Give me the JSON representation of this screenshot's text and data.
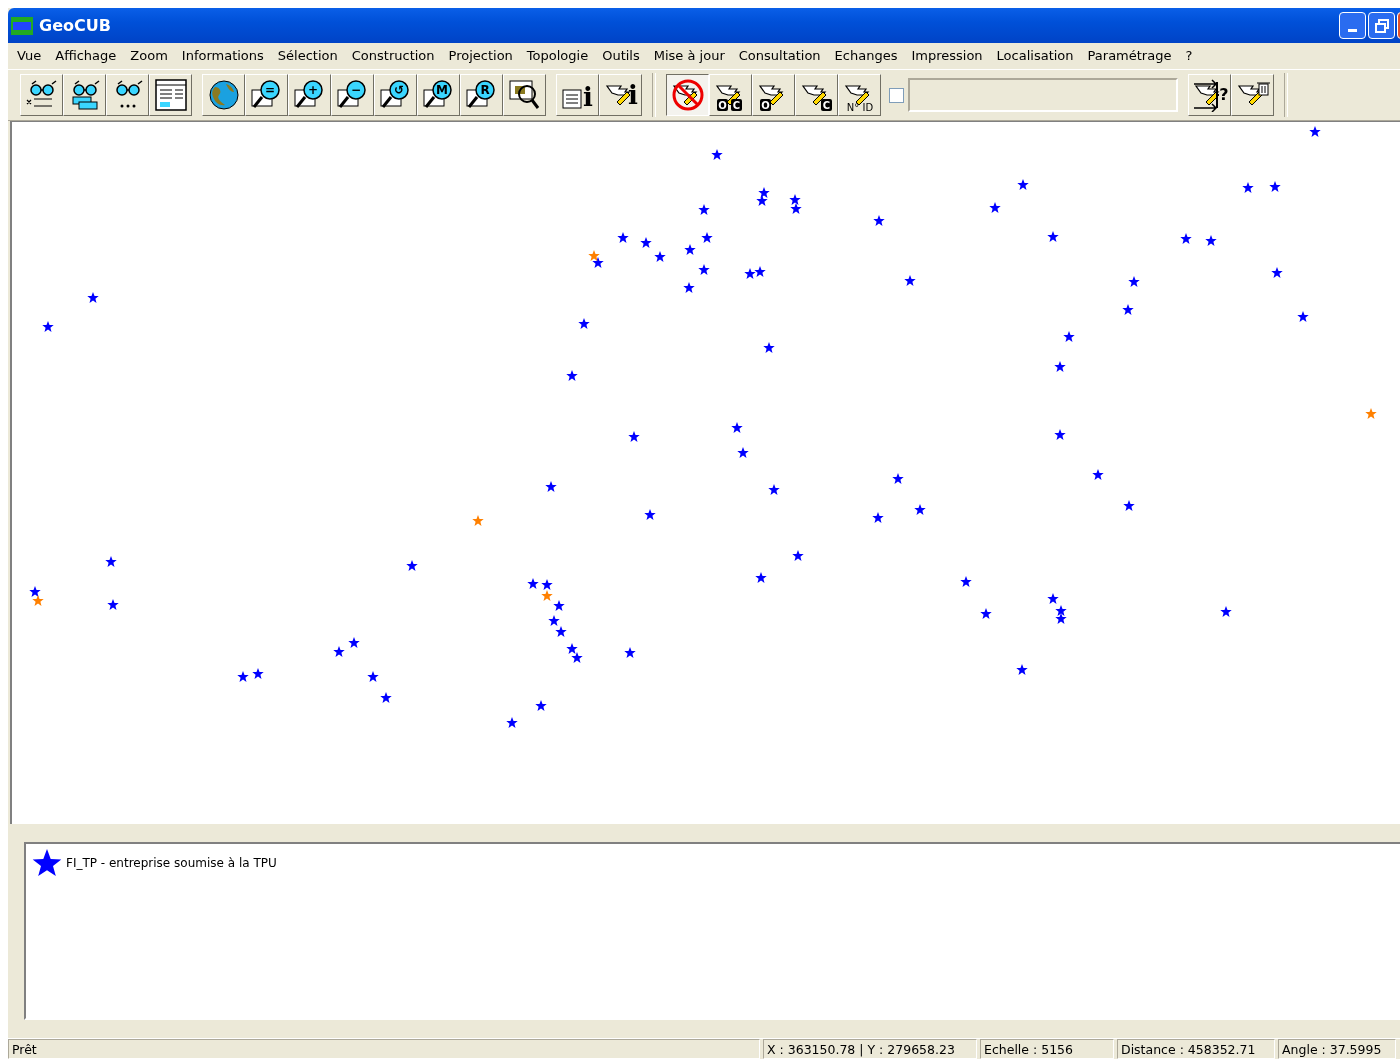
{
  "window": {
    "title": "GeoCUB"
  },
  "menu": [
    "Vue",
    "Affichage",
    "Zoom",
    "Informations",
    "Sélection",
    "Construction",
    "Projection",
    "Topologie",
    "Outils",
    "Mise à jour",
    "Consultation",
    "Echanges",
    "Impression",
    "Localisation",
    "Paramétrage",
    "?"
  ],
  "toolbar": {
    "groups": [
      [
        {
          "kind": "glasses-x",
          "pressed": false
        },
        {
          "kind": "glasses-layers",
          "pressed": false
        },
        {
          "kind": "glasses-dots",
          "pressed": false
        },
        {
          "kind": "table",
          "pressed": false
        }
      ],
      [
        {
          "kind": "globe",
          "pressed": false
        },
        {
          "kind": "zoom",
          "glyph": "=",
          "pressed": false
        },
        {
          "kind": "zoom",
          "glyph": "+",
          "pressed": false
        },
        {
          "kind": "zoom",
          "glyph": "−",
          "pressed": false
        },
        {
          "kind": "zoom",
          "glyph": "↺",
          "pressed": false
        },
        {
          "kind": "zoom",
          "glyph": "M",
          "pressed": false
        },
        {
          "kind": "zoom",
          "glyph": "R",
          "pressed": false
        },
        {
          "kind": "zoom-map",
          "pressed": false
        }
      ],
      [
        {
          "kind": "doc-info",
          "glyph": "i",
          "pressed": false
        },
        {
          "kind": "hand-info",
          "glyph": "i",
          "pressed": false
        }
      ],
      [
        {
          "kind": "hand-no",
          "pressed": true
        },
        {
          "kind": "hand",
          "tags": [
            "O",
            "C"
          ],
          "pressed": false
        },
        {
          "kind": "hand",
          "tags": [
            "O"
          ],
          "pressed": false
        },
        {
          "kind": "hand",
          "tags": [
            "C"
          ],
          "pressed": false
        },
        {
          "kind": "hand-text",
          "text": "N° ID",
          "pressed": false
        }
      ]
    ],
    "checkbox": {
      "checked": false
    },
    "right_group": [
      {
        "kind": "hand-query",
        "glyph": "?",
        "pressed": false
      },
      {
        "kind": "hand-trash",
        "pressed": false
      }
    ]
  },
  "legend": [
    {
      "label": "FI_TP - entreprise soumise à la TPU",
      "color": "#0000ff"
    }
  ],
  "status_bar": [
    "Prêt",
    "X : 363150.78 | Y : 279658.23",
    "Echelle : 5156",
    "Distance : 458352.71",
    "Angle : 37.5995"
  ]
}
